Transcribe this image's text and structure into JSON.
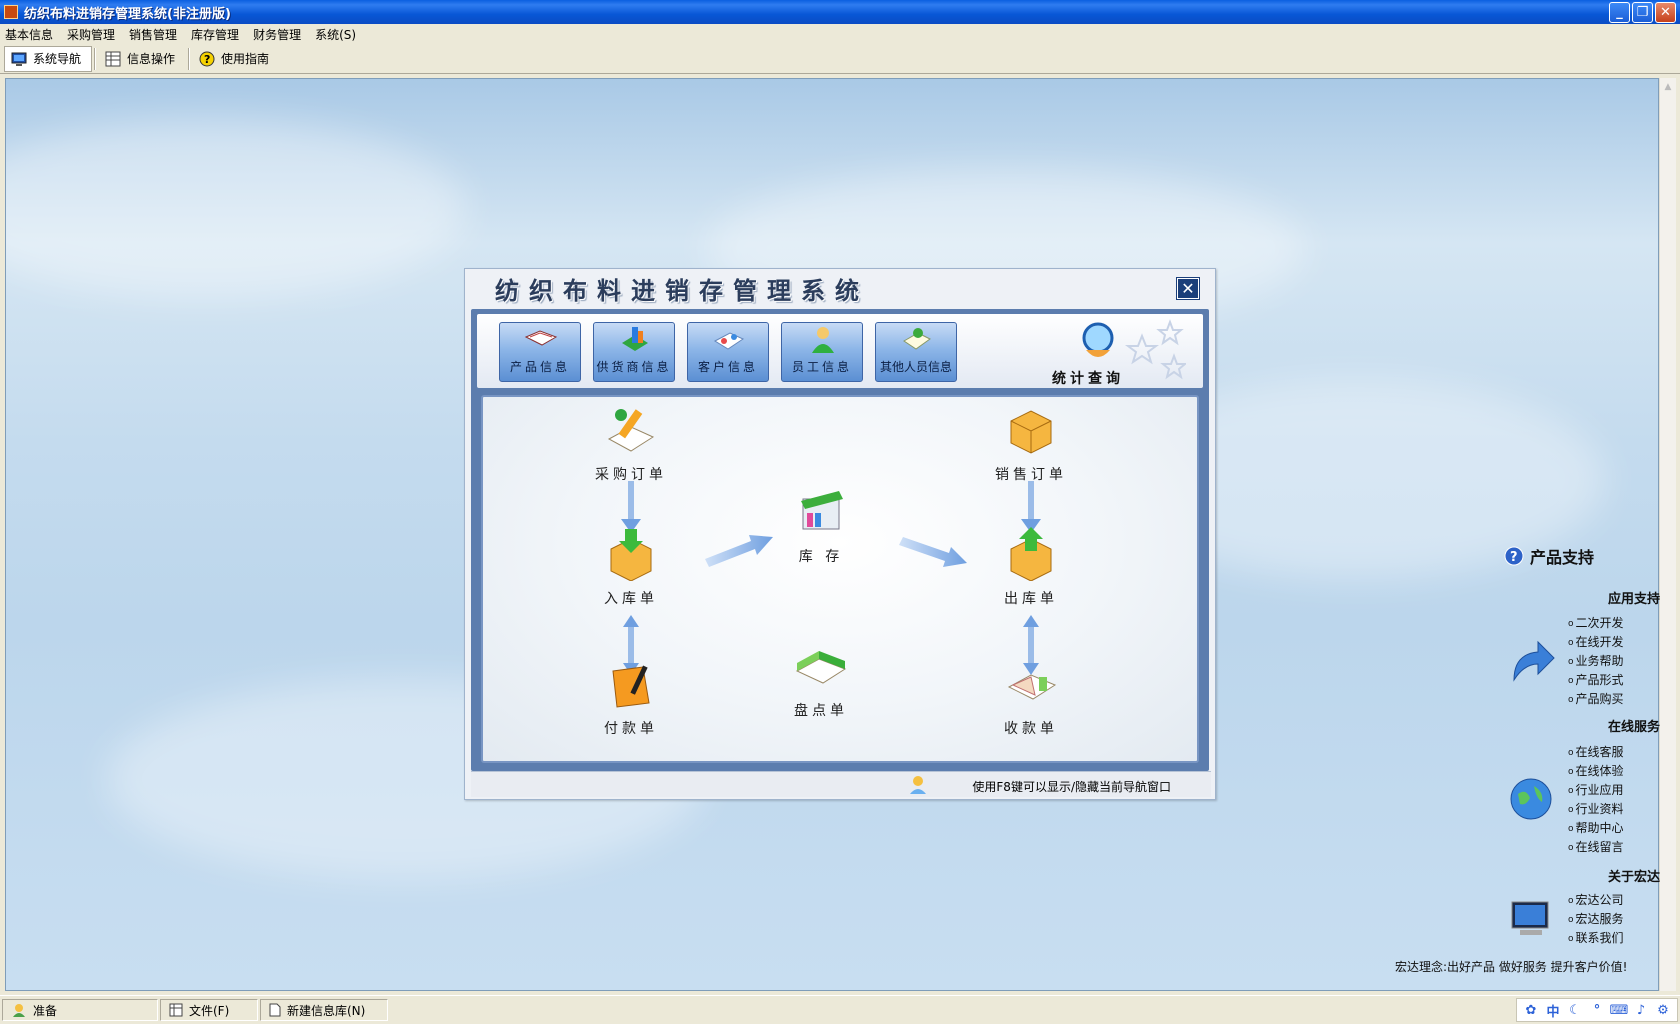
{
  "window": {
    "title": "纺织布料进销存管理系统(非注册版)",
    "minimize_label": "_",
    "maximize_label": "❐",
    "close_label": "✕"
  },
  "menu": [
    "基本信息",
    "采购管理",
    "销售管理",
    "库存管理",
    "财务管理",
    "系统(S)"
  ],
  "toolbar": {
    "nav_label": "系统导航",
    "info_label": "信息操作",
    "guide_label": "使用指南"
  },
  "dialog": {
    "title": "纺织布料进销存管理系统",
    "close_label": "✕",
    "info_buttons": [
      "产品信息",
      "供货商信息",
      "客户信息",
      "员工信息",
      "其他人员信息"
    ],
    "stats_label": "统计查询",
    "flow": {
      "purchase_order": "采购订单",
      "sales_order": "销售订单",
      "stock_in": "入库单",
      "inventory": "库 存",
      "stock_out": "出库单",
      "payment": "付款单",
      "stocktake": "盘点单",
      "receipt": "收款单"
    },
    "hint": "使用F8键可以显示/隐藏当前导航窗口"
  },
  "support": {
    "title": "产品支持",
    "app_support": {
      "heading": "应用支持",
      "links": [
        "二次开发",
        "在线开发",
        "业务帮助",
        "产品形式",
        "产品购买"
      ]
    },
    "online_service": {
      "heading": "在线服务",
      "links": [
        "在线客服",
        "在线体验",
        "行业应用",
        "行业资料",
        "帮助中心",
        "在线留言"
      ]
    },
    "about": {
      "heading": "关于宏达",
      "links": [
        "宏达公司",
        "宏达服务",
        "联系我们"
      ]
    },
    "motto": "宏达理念:出好产品  做好服务  提升客户价值!"
  },
  "statusbar": {
    "ready": "准备",
    "file": "文件(F)",
    "new_db": "新建信息库(N)",
    "tray_ime": "中"
  },
  "colors": {
    "titlebar": "#0a5fe0",
    "dialog_frame": "#5c7dae",
    "button_blue": "#8db6e8"
  }
}
